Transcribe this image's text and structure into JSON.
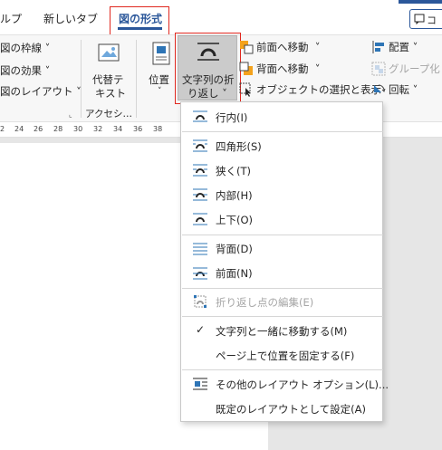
{
  "tabs": {
    "help": "ルプ",
    "newtab": "新しいタブ",
    "picture_format": "図の形式",
    "comment": "コ"
  },
  "ribbon": {
    "border": "図の枠線",
    "effects": "図の効果",
    "layout": "図のレイアウト",
    "alt_text_line1": "代替テ",
    "alt_text_line2": "キスト",
    "accessibility": "アクセシ…",
    "position": "位置",
    "wrap_line1": "文字列の折",
    "wrap_line2": "り返し",
    "bring_forward": "前面へ移動",
    "send_backward": "背面へ移動",
    "selection_pane": "オブジェクトの選択と表示",
    "align": "配置",
    "group": "グループ化",
    "rotate": "回転"
  },
  "ruler": [
    "2",
    "24",
    "26",
    "28",
    "30",
    "32",
    "34",
    "36",
    "38"
  ],
  "menu": {
    "items": [
      {
        "label": "行内(I)"
      },
      {
        "label": "四角形(S)"
      },
      {
        "label": "狭く(T)"
      },
      {
        "label": "内部(H)"
      },
      {
        "label": "上下(O)"
      },
      {
        "label": "背面(D)"
      },
      {
        "label": "前面(N)"
      },
      {
        "label": "折り返し点の編集(E)"
      },
      {
        "label": "文字列と一緒に移動する(M)"
      },
      {
        "label": "ページ上で位置を固定する(F)"
      },
      {
        "label": "その他のレイアウト オプション(L)..."
      },
      {
        "label": "既定のレイアウトとして設定(A)"
      }
    ]
  },
  "colors": {
    "accent": "#2b579a",
    "highlight_box": "#e0281f",
    "icon_blue": "#2e75b6",
    "icon_orange": "#f4a21c"
  }
}
